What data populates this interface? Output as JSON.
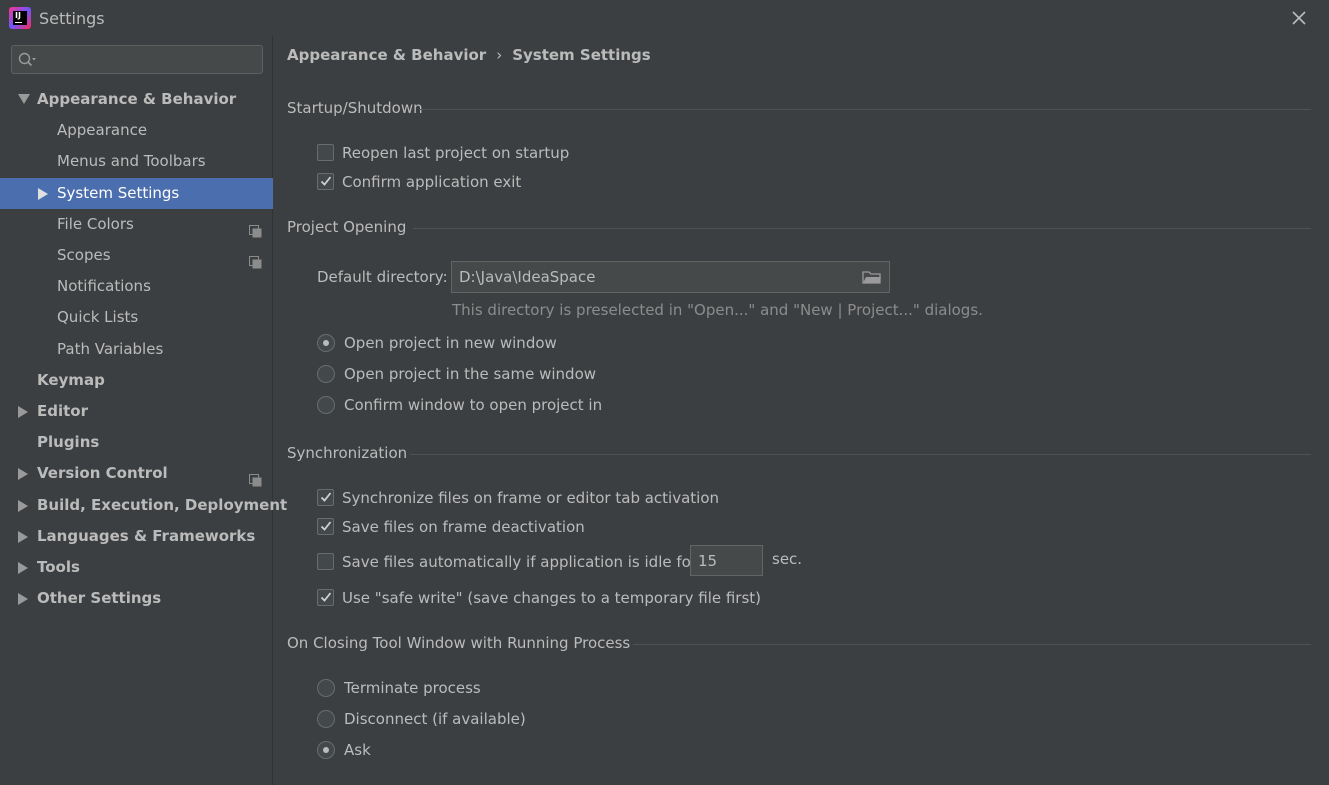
{
  "window": {
    "title": "Settings",
    "app_icon": "intellij-idea-icon",
    "close_icon": "close-icon"
  },
  "search": {
    "placeholder": "",
    "value": ""
  },
  "sidebar": {
    "items": [
      {
        "label": "Appearance & Behavior",
        "level": 0,
        "bold": true,
        "arrow": "expanded",
        "selected": false,
        "copy_icon": false
      },
      {
        "label": "Appearance",
        "level": 1,
        "bold": false,
        "arrow": "none",
        "selected": false,
        "copy_icon": false
      },
      {
        "label": "Menus and Toolbars",
        "level": 1,
        "bold": false,
        "arrow": "none",
        "selected": false,
        "copy_icon": false
      },
      {
        "label": "System Settings",
        "level": 1,
        "bold": false,
        "arrow": "collapsed",
        "selected": true,
        "copy_icon": false
      },
      {
        "label": "File Colors",
        "level": 1,
        "bold": false,
        "arrow": "none",
        "selected": false,
        "copy_icon": true
      },
      {
        "label": "Scopes",
        "level": 1,
        "bold": false,
        "arrow": "none",
        "selected": false,
        "copy_icon": true
      },
      {
        "label": "Notifications",
        "level": 1,
        "bold": false,
        "arrow": "none",
        "selected": false,
        "copy_icon": false
      },
      {
        "label": "Quick Lists",
        "level": 1,
        "bold": false,
        "arrow": "none",
        "selected": false,
        "copy_icon": false
      },
      {
        "label": "Path Variables",
        "level": 1,
        "bold": false,
        "arrow": "none",
        "selected": false,
        "copy_icon": false
      },
      {
        "label": "Keymap",
        "level": 0,
        "bold": true,
        "arrow": "none",
        "selected": false,
        "copy_icon": false
      },
      {
        "label": "Editor",
        "level": 0,
        "bold": true,
        "arrow": "collapsed",
        "selected": false,
        "copy_icon": false
      },
      {
        "label": "Plugins",
        "level": 0,
        "bold": true,
        "arrow": "none",
        "selected": false,
        "copy_icon": false
      },
      {
        "label": "Version Control",
        "level": 0,
        "bold": true,
        "arrow": "collapsed",
        "selected": false,
        "copy_icon": true
      },
      {
        "label": "Build, Execution, Deployment",
        "level": 0,
        "bold": true,
        "arrow": "collapsed",
        "selected": false,
        "copy_icon": false
      },
      {
        "label": "Languages & Frameworks",
        "level": 0,
        "bold": true,
        "arrow": "collapsed",
        "selected": false,
        "copy_icon": false
      },
      {
        "label": "Tools",
        "level": 0,
        "bold": true,
        "arrow": "collapsed",
        "selected": false,
        "copy_icon": false
      },
      {
        "label": "Other Settings",
        "level": 0,
        "bold": true,
        "arrow": "collapsed",
        "selected": false,
        "copy_icon": false
      }
    ]
  },
  "breadcrumb": {
    "parent": "Appearance & Behavior",
    "separator": "›",
    "current": "System Settings"
  },
  "sections": {
    "startup": {
      "title": "Startup/Shutdown",
      "options": [
        {
          "label": "Reopen last project on startup",
          "checked": false
        },
        {
          "label": "Confirm application exit",
          "checked": true
        }
      ]
    },
    "project_opening": {
      "title": "Project Opening",
      "default_dir_label": "Default directory:",
      "default_dir_value": "D:\\Java\\IdeaSpace",
      "hint": "This directory is preselected in \"Open...\" and \"New | Project...\" dialogs.",
      "options": [
        {
          "label": "Open project in new window",
          "selected": true
        },
        {
          "label": "Open project in the same window",
          "selected": false
        },
        {
          "label": "Confirm window to open project in",
          "selected": false
        }
      ]
    },
    "sync": {
      "title": "Synchronization",
      "options": [
        {
          "label": "Synchronize files on frame or editor tab activation",
          "checked": true
        },
        {
          "label": "Save files on frame deactivation",
          "checked": true
        },
        {
          "label": "Save files automatically if application is idle for",
          "checked": false
        },
        {
          "label": "Use \"safe write\" (save changes to a temporary file first)",
          "checked": true
        }
      ],
      "idle_value": "15",
      "idle_unit": "sec."
    },
    "closing": {
      "title": "On Closing Tool Window with Running Process",
      "options": [
        {
          "label": "Terminate process",
          "selected": false
        },
        {
          "label": "Disconnect (if available)",
          "selected": false
        },
        {
          "label": "Ask",
          "selected": true
        }
      ]
    }
  },
  "colors": {
    "background": "#3c3f41",
    "selection": "#4b6eaf",
    "text": "#bbbbbb",
    "hint": "#8c8c8c"
  }
}
